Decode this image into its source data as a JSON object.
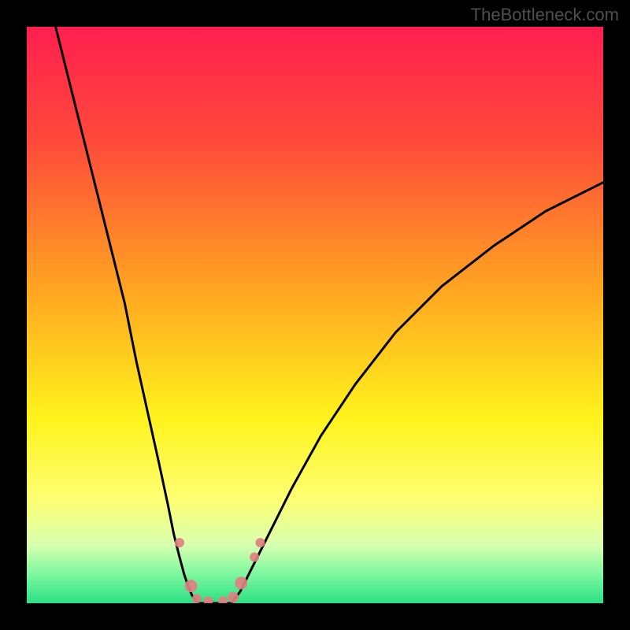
{
  "watermark": "TheBottleneck.com",
  "chart_data": {
    "type": "line",
    "title": "",
    "xlabel": "",
    "ylabel": "",
    "xlim": [
      0,
      100
    ],
    "ylim": [
      0,
      100
    ],
    "grid": false,
    "legend": false,
    "background_gradient_stops": [
      {
        "offset": 0.0,
        "color": "#ff1f4f"
      },
      {
        "offset": 0.2,
        "color": "#ff4a3a"
      },
      {
        "offset": 0.45,
        "color": "#ffa321"
      },
      {
        "offset": 0.68,
        "color": "#fff31c"
      },
      {
        "offset": 0.82,
        "color": "#fdff72"
      },
      {
        "offset": 0.9,
        "color": "#d7ffb0"
      },
      {
        "offset": 0.95,
        "color": "#7cf7a0"
      },
      {
        "offset": 1.0,
        "color": "#2ce084"
      }
    ],
    "green_band": {
      "y_min": 0,
      "y_max": 6
    },
    "series": [
      {
        "name": "left-branch",
        "x": [
          5,
          8,
          11,
          14,
          17,
          19,
          21,
          23,
          24.5,
          25.5,
          26.5,
          27.3,
          28.0,
          28.6,
          29.2,
          29.8
        ],
        "y": [
          100,
          88,
          76,
          64,
          52,
          42,
          33,
          24,
          17,
          12,
          8,
          5,
          3,
          1.5,
          0.6,
          0
        ]
      },
      {
        "name": "valley-floor",
        "x": [
          29.8,
          31.0,
          32.5,
          34.0,
          35.5
        ],
        "y": [
          0,
          0,
          0,
          0,
          0
        ]
      },
      {
        "name": "right-branch",
        "x": [
          35.5,
          37,
          39,
          42,
          46,
          51,
          57,
          64,
          72,
          81,
          90,
          100
        ],
        "y": [
          0,
          2,
          6,
          12,
          20,
          29,
          38,
          47,
          55,
          62,
          68,
          73
        ]
      }
    ],
    "markers": {
      "color": "#e08080",
      "points": [
        {
          "x": 26.5,
          "y": 10.5,
          "r": 6
        },
        {
          "x": 28.5,
          "y": 3.0,
          "r": 8
        },
        {
          "x": 29.5,
          "y": 0.8,
          "r": 6
        },
        {
          "x": 31.5,
          "y": 0.4,
          "r": 6
        },
        {
          "x": 34.0,
          "y": 0.4,
          "r": 6
        },
        {
          "x": 35.8,
          "y": 1.0,
          "r": 7
        },
        {
          "x": 37.2,
          "y": 3.5,
          "r": 8
        },
        {
          "x": 39.5,
          "y": 8.0,
          "r": 6
        },
        {
          "x": 40.5,
          "y": 10.5,
          "r": 6
        }
      ]
    }
  }
}
